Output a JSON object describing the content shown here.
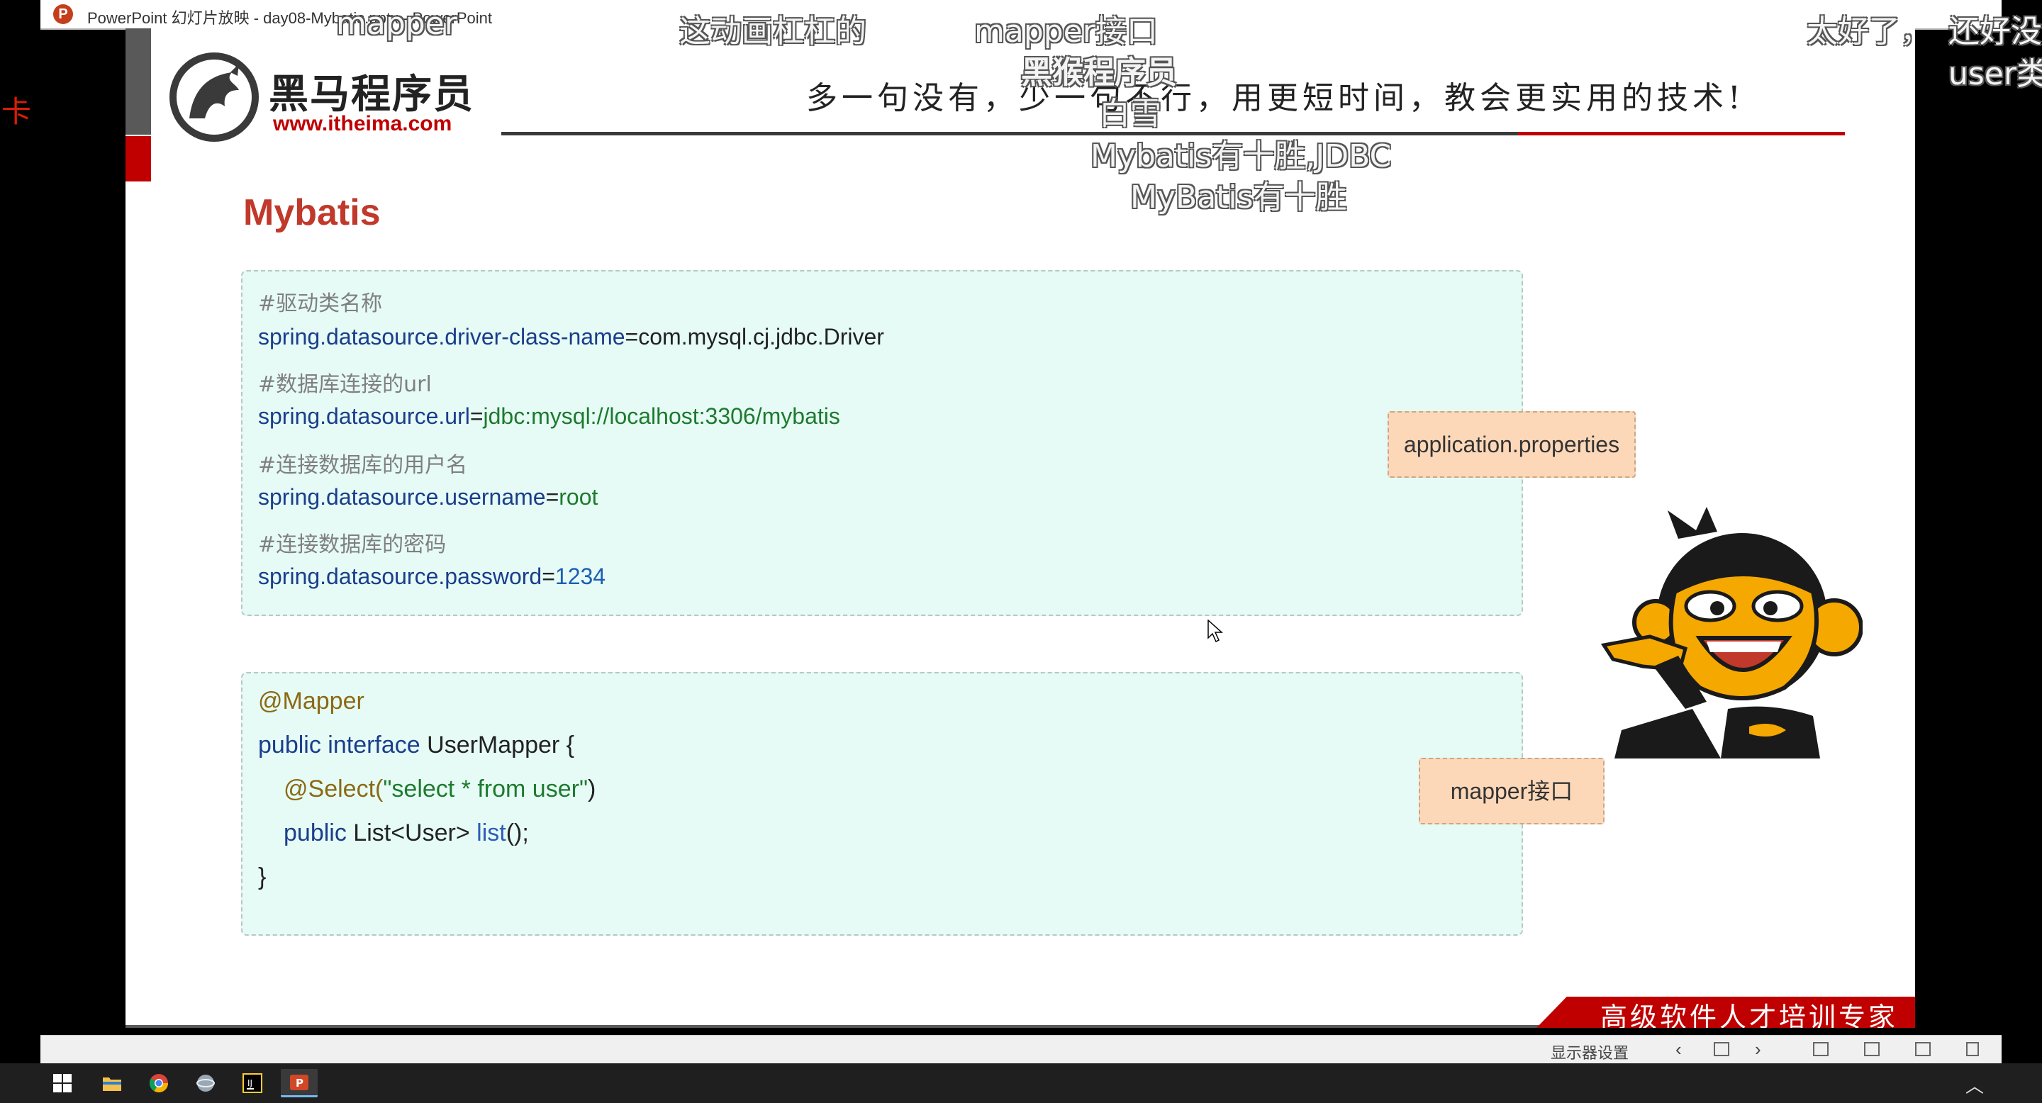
{
  "window": {
    "title": "PowerPoint 幻灯片放映  -  day08-Mybatis.pptx - PowerPoint"
  },
  "left_edge_char": "卡",
  "slide": {
    "brand_name": "黑马程序员",
    "brand_site": "www.itheima.com",
    "slogan": "多一句没有，少一句不行，用更短时间，教会更实用的技术!",
    "title": "Mybatis",
    "properties_box": {
      "lines": [
        {
          "type": "comment",
          "text": "#驱动类名称"
        },
        {
          "type": "prop",
          "key": "spring.datasource.driver-class-name",
          "value": "com.mysql.cj.jdbc.Driver",
          "value_color": "#222222"
        },
        {
          "type": "comment",
          "text": "#数据库连接的url"
        },
        {
          "type": "prop",
          "key": "spring.datasource.url",
          "value": "jdbc:mysql://localhost:3306/mybatis",
          "value_color": "#1d7a2e"
        },
        {
          "type": "comment",
          "text": "#连接数据库的用户名"
        },
        {
          "type": "prop",
          "key": "spring.datasource.username",
          "value": "root",
          "value_color": "#1d7a2e"
        },
        {
          "type": "comment",
          "text": "#连接数据库的密码"
        },
        {
          "type": "prop",
          "key": "spring.datasource.password",
          "value": "1234",
          "value_color": "#1a5fb4"
        }
      ],
      "tag": "application.properties"
    },
    "mapper_box": {
      "annotation": "@Mapper",
      "decl_keyword": "public interface",
      "decl_name": "UserMapper {",
      "select_annotation": "@Select(",
      "select_query": "\"select  *  from  user\"",
      "select_close": ")",
      "method_modifier": "public",
      "method_type": "List<User>",
      "method_name": "list",
      "method_end": "();",
      "closing_brace": "}",
      "tag": "mapper接口"
    },
    "footer_badge": "高级软件人才培训专家"
  },
  "danmaku": [
    {
      "text": "mapper",
      "bold": false
    },
    {
      "text": "这动画杠杠的",
      "bold": false
    },
    {
      "text": "mapper接口",
      "bold": false
    },
    {
      "text": "太好了，",
      "bold": false
    },
    {
      "text": "还好没",
      "bold": false
    },
    {
      "text": "user类",
      "bold": false
    },
    {
      "text": "黑猴程序员",
      "bold": true
    },
    {
      "text": "白雪",
      "bold": false
    },
    {
      "text": "Mybatis有十胜,JDBC",
      "bold": false
    },
    {
      "text": "MyBatis有十胜",
      "bold": false
    },
    {
      "text": "黑马程序员",
      "bold": false
    }
  ],
  "statusbar": {
    "display_settings": "显示器设置"
  },
  "taskbar": {
    "items": [
      "start-icon",
      "file-explorer-icon",
      "chrome-icon",
      "browser-icon",
      "intellij-icon",
      "powerpoint-icon"
    ]
  }
}
